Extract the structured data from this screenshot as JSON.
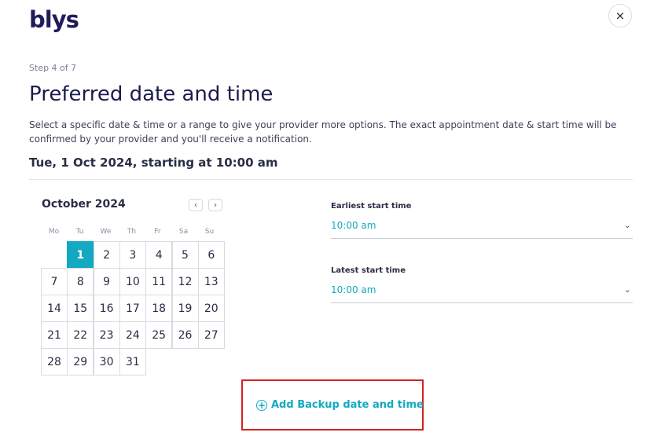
{
  "header": {
    "logo_text": "blys",
    "close_icon": "×"
  },
  "step_text": "Step 4 of 7",
  "title": "Preferred date and time",
  "description": "Select a specific date & time or a range to give your provider more options. The exact appointment date & start time will be confirmed by your provider and you'll receive a notification.",
  "selected_summary": "Tue, 1 Oct 2024, starting at 10:00 am",
  "calendar": {
    "month_label": "October 2024",
    "prev_icon": "‹",
    "next_icon": "›",
    "weekdays": [
      "Mo",
      "Tu",
      "We",
      "Th",
      "Fr",
      "Sa",
      "Su"
    ],
    "days": [
      "1",
      "2",
      "3",
      "4",
      "5",
      "6",
      "7",
      "8",
      "9",
      "10",
      "11",
      "12",
      "13",
      "14",
      "15",
      "16",
      "17",
      "18",
      "19",
      "20",
      "21",
      "22",
      "23",
      "24",
      "25",
      "26",
      "27",
      "28",
      "29",
      "30",
      "31"
    ],
    "selected_day": "1"
  },
  "earliest": {
    "label": "Earliest start time",
    "value": "10:00 am",
    "chevron": "⌄"
  },
  "latest": {
    "label": "Latest start time",
    "value": "10:00 am",
    "chevron": "⌄"
  },
  "backup": {
    "label": "Add Backup date and time",
    "icon": "+"
  },
  "colors": {
    "accent": "#12a9c1",
    "brand": "#1f1c5c",
    "highlight_box": "#d62020"
  }
}
